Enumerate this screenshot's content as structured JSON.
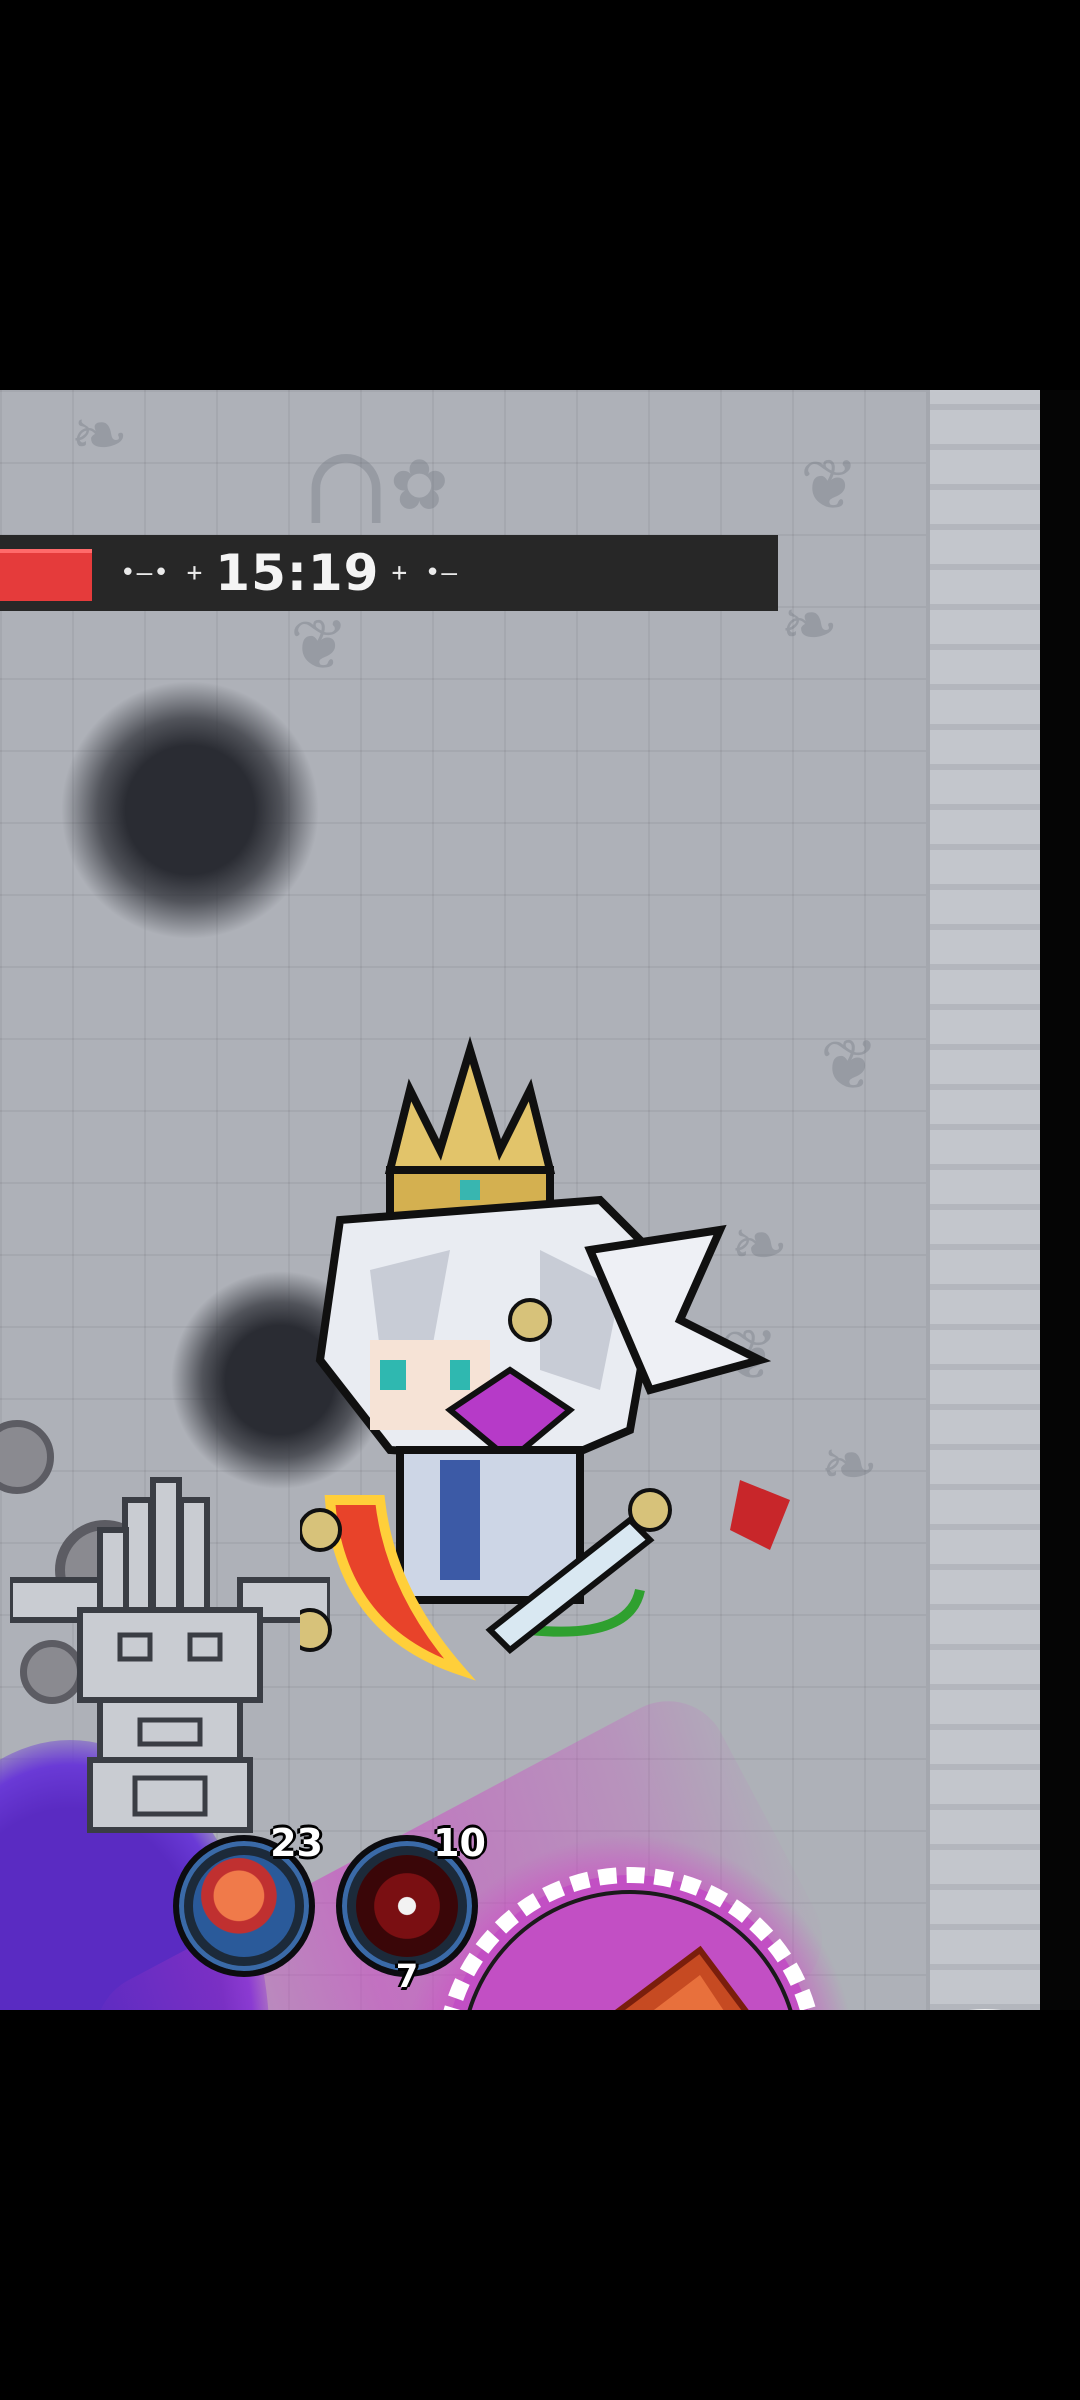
{
  "hud": {
    "timer": "15:19",
    "timer_deco_left": "•—• +",
    "timer_deco_right": "+ •—",
    "health_fraction": 0.118,
    "health_color": "#e53b3b"
  },
  "skills": [
    {
      "name": "fighter-skill",
      "count": "23",
      "sub": ""
    },
    {
      "name": "maw-skill",
      "count": "10",
      "sub": "7"
    }
  ],
  "controls": {
    "attack_icon": "fork-knife-icon"
  },
  "colors": {
    "floor": "#aeb1b8",
    "wall": "#c3c6cc",
    "hud_bar": "#272727",
    "purple_pool": "#5a2bc2",
    "pickup_glow": "#d23cc8"
  },
  "pickup": {
    "icon": "meat-icon"
  }
}
